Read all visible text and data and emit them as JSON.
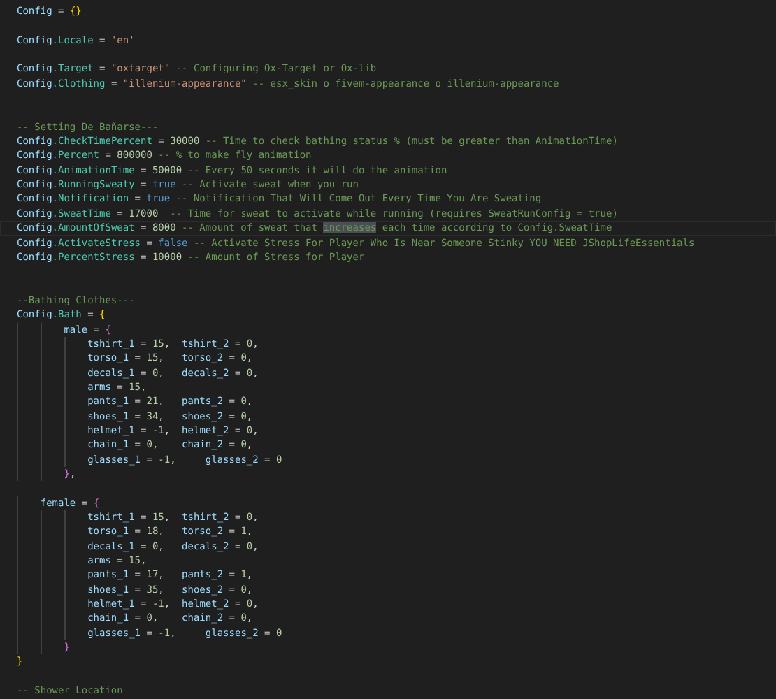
{
  "editor": {
    "lines": [
      {
        "current": false,
        "tokens": [
          {
            "kind": "var",
            "text": "Config"
          },
          {
            "kind": "op",
            "text": " = "
          },
          {
            "kind": "brace1",
            "text": "{}"
          }
        ]
      },
      {
        "current": false
      },
      {
        "current": false,
        "tokens": [
          {
            "kind": "var",
            "text": "Config"
          },
          {
            "kind": "prop",
            "text": ".Locale"
          },
          {
            "kind": "op",
            "text": " = "
          },
          {
            "kind": "str",
            "text": "'en'"
          }
        ]
      },
      {
        "current": false
      },
      {
        "current": false,
        "tokens": [
          {
            "kind": "var",
            "text": "Config"
          },
          {
            "kind": "prop",
            "text": ".Target"
          },
          {
            "kind": "op",
            "text": " = "
          },
          {
            "kind": "str",
            "text": "\"oxtarget\""
          },
          {
            "kind": "comment",
            "text": " -- Configuring Ox-Target or Ox-lib"
          }
        ]
      },
      {
        "current": false,
        "tokens": [
          {
            "kind": "var",
            "text": "Config"
          },
          {
            "kind": "prop",
            "text": ".Clothing"
          },
          {
            "kind": "op",
            "text": " = "
          },
          {
            "kind": "str",
            "text": "\"illenium-appearance\""
          },
          {
            "kind": "comment",
            "text": " -- esx_skin o fivem-appearance o illenium-appearance"
          }
        ]
      },
      {
        "current": false
      },
      {
        "current": false
      },
      {
        "current": false,
        "tokens": [
          {
            "kind": "comment",
            "text": "-- Setting De Bañarse---"
          }
        ]
      },
      {
        "current": false,
        "tokens": [
          {
            "kind": "var",
            "text": "Config"
          },
          {
            "kind": "prop",
            "text": ".CheckTimePercent"
          },
          {
            "kind": "op",
            "text": " = "
          },
          {
            "kind": "num",
            "text": "30000"
          },
          {
            "kind": "comment",
            "text": " -- Time to check bathing status % (must be greater than AnimationTime)"
          }
        ]
      },
      {
        "current": false,
        "tokens": [
          {
            "kind": "var",
            "text": "Config"
          },
          {
            "kind": "prop",
            "text": ".Percent"
          },
          {
            "kind": "op",
            "text": " = "
          },
          {
            "kind": "num",
            "text": "800000"
          },
          {
            "kind": "comment",
            "text": " -- % to make fly animation"
          }
        ]
      },
      {
        "current": false,
        "tokens": [
          {
            "kind": "var",
            "text": "Config"
          },
          {
            "kind": "prop",
            "text": ".AnimationTime"
          },
          {
            "kind": "op",
            "text": " = "
          },
          {
            "kind": "num",
            "text": "50000"
          },
          {
            "kind": "comment",
            "text": " -- Every 50 seconds it will do the animation"
          }
        ]
      },
      {
        "current": false,
        "tokens": [
          {
            "kind": "var",
            "text": "Config"
          },
          {
            "kind": "prop",
            "text": ".RunningSweaty"
          },
          {
            "kind": "op",
            "text": " = "
          },
          {
            "kind": "kw",
            "text": "true"
          },
          {
            "kind": "comment",
            "text": " -- Activate sweat when you run"
          }
        ]
      },
      {
        "current": false,
        "tokens": [
          {
            "kind": "var",
            "text": "Config"
          },
          {
            "kind": "prop",
            "text": ".Notification"
          },
          {
            "kind": "op",
            "text": " = "
          },
          {
            "kind": "kw",
            "text": "true"
          },
          {
            "kind": "comment",
            "text": " -- Notification That Will Come Out Every Time You Are Sweating"
          }
        ]
      },
      {
        "current": false,
        "tokens": [
          {
            "kind": "var",
            "text": "Config"
          },
          {
            "kind": "prop",
            "text": ".SweatTime"
          },
          {
            "kind": "op",
            "text": " = "
          },
          {
            "kind": "num",
            "text": "17000"
          },
          {
            "kind": "comment",
            "text": "  -- Time for sweat to activate while running (requires SweatRunConfig = true)"
          }
        ]
      },
      {
        "current": true,
        "tokens": [
          {
            "kind": "var",
            "text": "Config"
          },
          {
            "kind": "prop",
            "text": ".AmountOfSweat"
          },
          {
            "kind": "op",
            "text": " = "
          },
          {
            "kind": "num",
            "text": "8000"
          },
          {
            "kind": "comment",
            "text": " -- Amount of sweat that "
          },
          {
            "kind": "comment",
            "text": "increases",
            "highlighted": true
          },
          {
            "kind": "comment",
            "text": " each time according to Config.SweatTime"
          }
        ]
      },
      {
        "current": false,
        "tokens": [
          {
            "kind": "var",
            "text": "Config"
          },
          {
            "kind": "prop",
            "text": ".ActivateStress"
          },
          {
            "kind": "op",
            "text": " = "
          },
          {
            "kind": "kw",
            "text": "false"
          },
          {
            "kind": "comment",
            "text": " -- Activate Stress For Player Who Is Near Someone Stinky YOU NEED JShopLifeEssentials"
          }
        ]
      },
      {
        "current": false,
        "tokens": [
          {
            "kind": "var",
            "text": "Config"
          },
          {
            "kind": "prop",
            "text": ".PercentStress"
          },
          {
            "kind": "op",
            "text": " = "
          },
          {
            "kind": "num",
            "text": "10000"
          },
          {
            "kind": "comment",
            "text": " -- Amount of Stress for Player"
          }
        ]
      },
      {
        "current": false
      },
      {
        "current": false
      },
      {
        "current": false,
        "tokens": [
          {
            "kind": "comment",
            "text": "--Bathing Clothes---"
          }
        ]
      },
      {
        "current": false,
        "tokens": [
          {
            "kind": "var",
            "text": "Config"
          },
          {
            "kind": "prop",
            "text": ".Bath"
          },
          {
            "kind": "op",
            "text": " = "
          },
          {
            "kind": "brace1",
            "text": "{"
          }
        ]
      },
      {
        "current": false,
        "tokens": [
          {
            "kind": "key",
            "text": "        male"
          },
          {
            "kind": "op",
            "text": " = "
          },
          {
            "kind": "brace2",
            "text": "{"
          }
        ]
      },
      {
        "current": false,
        "tokens": [
          {
            "kind": "key",
            "text": "            tshirt_1"
          },
          {
            "kind": "op",
            "text": " = "
          },
          {
            "kind": "num",
            "text": "15"
          },
          {
            "kind": "op",
            "text": ",  "
          },
          {
            "kind": "key",
            "text": "tshirt_2"
          },
          {
            "kind": "op",
            "text": " = "
          },
          {
            "kind": "num",
            "text": "0"
          },
          {
            "kind": "op",
            "text": ","
          }
        ]
      },
      {
        "current": false,
        "tokens": [
          {
            "kind": "key",
            "text": "            torso_1"
          },
          {
            "kind": "op",
            "text": " = "
          },
          {
            "kind": "num",
            "text": "15"
          },
          {
            "kind": "op",
            "text": ",   "
          },
          {
            "kind": "key",
            "text": "torso_2"
          },
          {
            "kind": "op",
            "text": " = "
          },
          {
            "kind": "num",
            "text": "0"
          },
          {
            "kind": "op",
            "text": ","
          }
        ]
      },
      {
        "current": false,
        "tokens": [
          {
            "kind": "key",
            "text": "            decals_1"
          },
          {
            "kind": "op",
            "text": " = "
          },
          {
            "kind": "num",
            "text": "0"
          },
          {
            "kind": "op",
            "text": ",   "
          },
          {
            "kind": "key",
            "text": "decals_2"
          },
          {
            "kind": "op",
            "text": " = "
          },
          {
            "kind": "num",
            "text": "0"
          },
          {
            "kind": "op",
            "text": ","
          }
        ]
      },
      {
        "current": false,
        "tokens": [
          {
            "kind": "key",
            "text": "            arms"
          },
          {
            "kind": "op",
            "text": " = "
          },
          {
            "kind": "num",
            "text": "15"
          },
          {
            "kind": "op",
            "text": ","
          }
        ]
      },
      {
        "current": false,
        "tokens": [
          {
            "kind": "key",
            "text": "            pants_1"
          },
          {
            "kind": "op",
            "text": " = "
          },
          {
            "kind": "num",
            "text": "21"
          },
          {
            "kind": "op",
            "text": ",   "
          },
          {
            "kind": "key",
            "text": "pants_2"
          },
          {
            "kind": "op",
            "text": " = "
          },
          {
            "kind": "num",
            "text": "0"
          },
          {
            "kind": "op",
            "text": ","
          }
        ]
      },
      {
        "current": false,
        "tokens": [
          {
            "kind": "key",
            "text": "            shoes_1"
          },
          {
            "kind": "op",
            "text": " = "
          },
          {
            "kind": "num",
            "text": "34"
          },
          {
            "kind": "op",
            "text": ",   "
          },
          {
            "kind": "key",
            "text": "shoes_2"
          },
          {
            "kind": "op",
            "text": " = "
          },
          {
            "kind": "num",
            "text": "0"
          },
          {
            "kind": "op",
            "text": ","
          }
        ]
      },
      {
        "current": false,
        "tokens": [
          {
            "kind": "key",
            "text": "            helmet_1"
          },
          {
            "kind": "op",
            "text": " = "
          },
          {
            "kind": "num",
            "text": "-1"
          },
          {
            "kind": "op",
            "text": ",  "
          },
          {
            "kind": "key",
            "text": "helmet_2"
          },
          {
            "kind": "op",
            "text": " = "
          },
          {
            "kind": "num",
            "text": "0"
          },
          {
            "kind": "op",
            "text": ","
          }
        ]
      },
      {
        "current": false,
        "tokens": [
          {
            "kind": "key",
            "text": "            chain_1"
          },
          {
            "kind": "op",
            "text": " = "
          },
          {
            "kind": "num",
            "text": "0"
          },
          {
            "kind": "op",
            "text": ",    "
          },
          {
            "kind": "key",
            "text": "chain_2"
          },
          {
            "kind": "op",
            "text": " = "
          },
          {
            "kind": "num",
            "text": "0"
          },
          {
            "kind": "op",
            "text": ","
          }
        ]
      },
      {
        "current": false,
        "tokens": [
          {
            "kind": "key",
            "text": "            glasses_1"
          },
          {
            "kind": "op",
            "text": " = "
          },
          {
            "kind": "num",
            "text": "-1"
          },
          {
            "kind": "op",
            "text": ",     "
          },
          {
            "kind": "key",
            "text": "glasses_2"
          },
          {
            "kind": "op",
            "text": " = "
          },
          {
            "kind": "num",
            "text": "0"
          }
        ]
      },
      {
        "current": false,
        "tokens": [
          {
            "kind": "brace2",
            "text": "        }"
          },
          {
            "kind": "op",
            "text": ","
          }
        ]
      },
      {
        "current": false
      },
      {
        "current": false,
        "tokens": [
          {
            "kind": "key",
            "text": "    female"
          },
          {
            "kind": "op",
            "text": " = "
          },
          {
            "kind": "brace2",
            "text": "{"
          }
        ]
      },
      {
        "current": false,
        "tokens": [
          {
            "kind": "key",
            "text": "            tshirt_1"
          },
          {
            "kind": "op",
            "text": " = "
          },
          {
            "kind": "num",
            "text": "15"
          },
          {
            "kind": "op",
            "text": ",  "
          },
          {
            "kind": "key",
            "text": "tshirt_2"
          },
          {
            "kind": "op",
            "text": " = "
          },
          {
            "kind": "num",
            "text": "0"
          },
          {
            "kind": "op",
            "text": ","
          }
        ]
      },
      {
        "current": false,
        "tokens": [
          {
            "kind": "key",
            "text": "            torso_1"
          },
          {
            "kind": "op",
            "text": " = "
          },
          {
            "kind": "num",
            "text": "18"
          },
          {
            "kind": "op",
            "text": ",   "
          },
          {
            "kind": "key",
            "text": "torso_2"
          },
          {
            "kind": "op",
            "text": " = "
          },
          {
            "kind": "num",
            "text": "1"
          },
          {
            "kind": "op",
            "text": ","
          }
        ]
      },
      {
        "current": false,
        "tokens": [
          {
            "kind": "key",
            "text": "            decals_1"
          },
          {
            "kind": "op",
            "text": " = "
          },
          {
            "kind": "num",
            "text": "0"
          },
          {
            "kind": "op",
            "text": ",   "
          },
          {
            "kind": "key",
            "text": "decals_2"
          },
          {
            "kind": "op",
            "text": " = "
          },
          {
            "kind": "num",
            "text": "0"
          },
          {
            "kind": "op",
            "text": ","
          }
        ]
      },
      {
        "current": false,
        "tokens": [
          {
            "kind": "key",
            "text": "            arms"
          },
          {
            "kind": "op",
            "text": " = "
          },
          {
            "kind": "num",
            "text": "15"
          },
          {
            "kind": "op",
            "text": ","
          }
        ]
      },
      {
        "current": false,
        "tokens": [
          {
            "kind": "key",
            "text": "            pants_1"
          },
          {
            "kind": "op",
            "text": " = "
          },
          {
            "kind": "num",
            "text": "17"
          },
          {
            "kind": "op",
            "text": ",   "
          },
          {
            "kind": "key",
            "text": "pants_2"
          },
          {
            "kind": "op",
            "text": " = "
          },
          {
            "kind": "num",
            "text": "1"
          },
          {
            "kind": "op",
            "text": ","
          }
        ]
      },
      {
        "current": false,
        "tokens": [
          {
            "kind": "key",
            "text": "            shoes_1"
          },
          {
            "kind": "op",
            "text": " = "
          },
          {
            "kind": "num",
            "text": "35"
          },
          {
            "kind": "op",
            "text": ",   "
          },
          {
            "kind": "key",
            "text": "shoes_2"
          },
          {
            "kind": "op",
            "text": " = "
          },
          {
            "kind": "num",
            "text": "0"
          },
          {
            "kind": "op",
            "text": ","
          }
        ]
      },
      {
        "current": false,
        "tokens": [
          {
            "kind": "key",
            "text": "            helmet_1"
          },
          {
            "kind": "op",
            "text": " = "
          },
          {
            "kind": "num",
            "text": "-1"
          },
          {
            "kind": "op",
            "text": ",  "
          },
          {
            "kind": "key",
            "text": "helmet_2"
          },
          {
            "kind": "op",
            "text": " = "
          },
          {
            "kind": "num",
            "text": "0"
          },
          {
            "kind": "op",
            "text": ","
          }
        ]
      },
      {
        "current": false,
        "tokens": [
          {
            "kind": "key",
            "text": "            chain_1"
          },
          {
            "kind": "op",
            "text": " = "
          },
          {
            "kind": "num",
            "text": "0"
          },
          {
            "kind": "op",
            "text": ",    "
          },
          {
            "kind": "key",
            "text": "chain_2"
          },
          {
            "kind": "op",
            "text": " = "
          },
          {
            "kind": "num",
            "text": "0"
          },
          {
            "kind": "op",
            "text": ","
          }
        ]
      },
      {
        "current": false,
        "tokens": [
          {
            "kind": "key",
            "text": "            glasses_1"
          },
          {
            "kind": "op",
            "text": " = "
          },
          {
            "kind": "num",
            "text": "-1"
          },
          {
            "kind": "op",
            "text": ",     "
          },
          {
            "kind": "key",
            "text": "glasses_2"
          },
          {
            "kind": "op",
            "text": " = "
          },
          {
            "kind": "num",
            "text": "0"
          }
        ]
      },
      {
        "current": false,
        "tokens": [
          {
            "kind": "brace2",
            "text": "        }"
          }
        ]
      },
      {
        "current": false,
        "tokens": [
          {
            "kind": "brace1",
            "text": "}"
          }
        ]
      },
      {
        "current": false
      },
      {
        "current": false,
        "tokens": [
          {
            "kind": "comment",
            "text": "-- Shower Location"
          }
        ]
      }
    ]
  }
}
